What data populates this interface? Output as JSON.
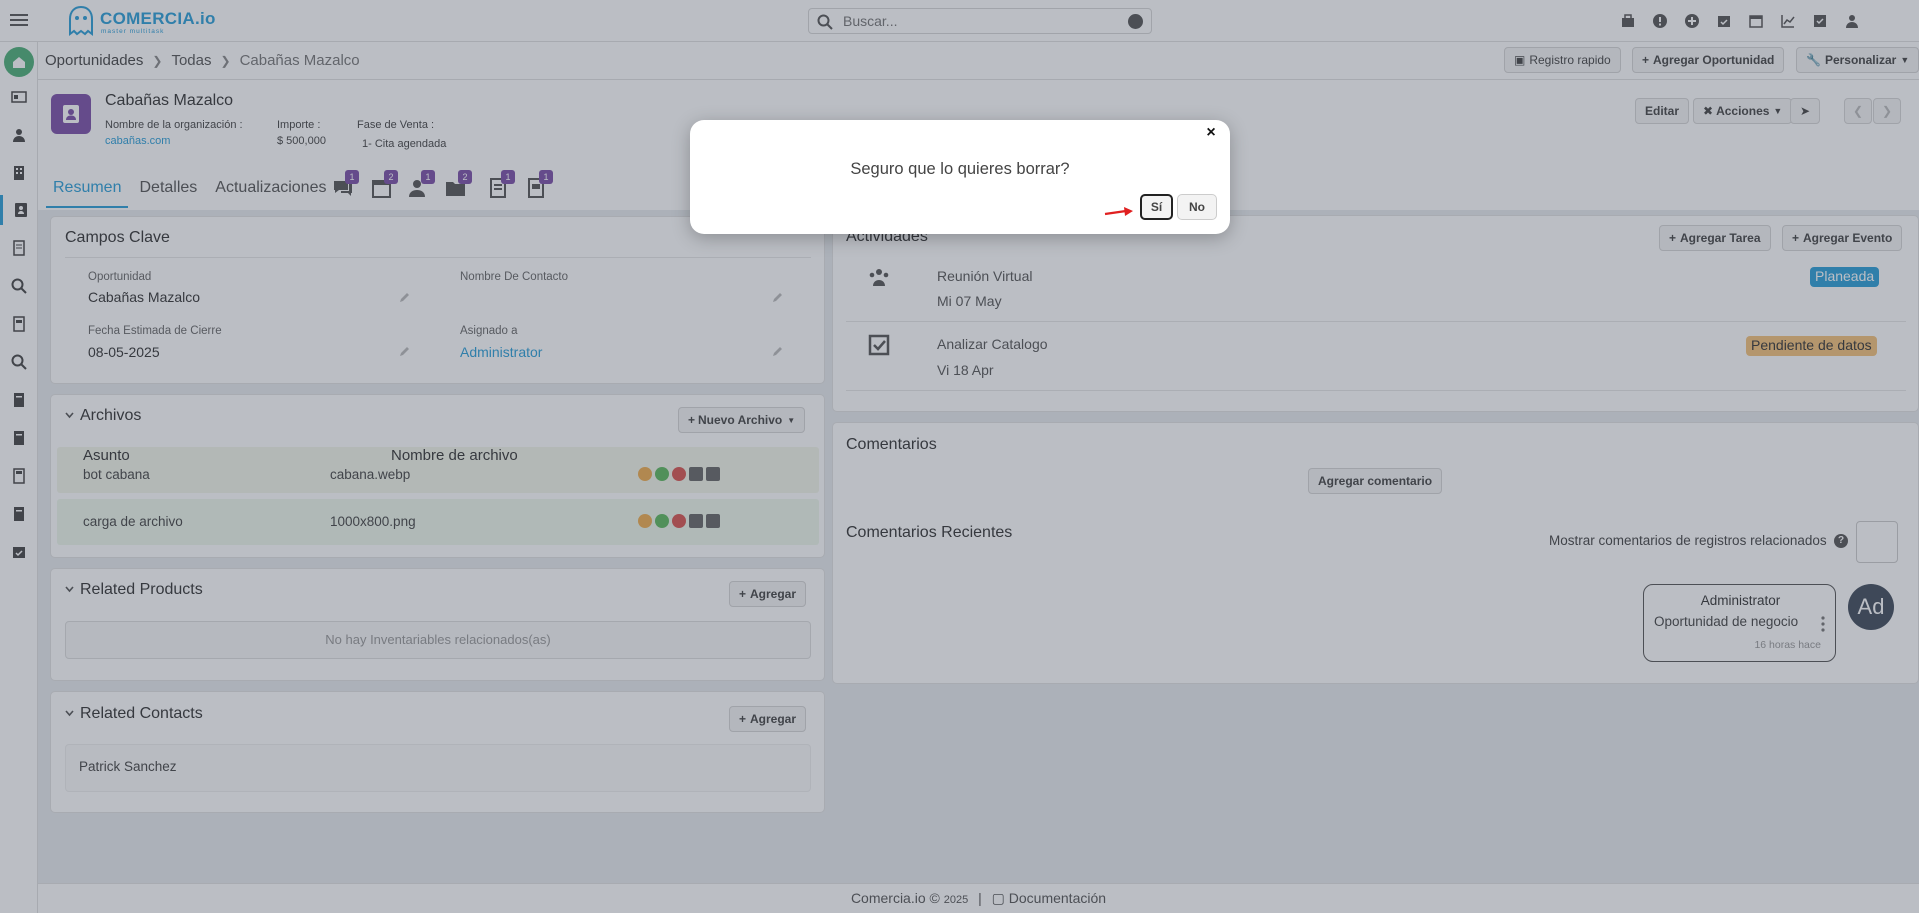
{
  "app": {
    "logo_text": "COMERCIA.io",
    "logo_sub": "master multitask",
    "search_placeholder": "Buscar..."
  },
  "top_icons": [
    "briefcase-icon",
    "alert-icon",
    "plus-circle-icon",
    "calendar-check-icon",
    "calendar-icon",
    "chart-icon",
    "checkbox-icon",
    "user-icon"
  ],
  "sidebar": [
    "home-icon",
    "id-card-icon",
    "person-icon",
    "building-icon",
    "contact-icon",
    "book-icon",
    "search-plus-icon",
    "ledger-icon",
    "search-icon",
    "book-2-icon",
    "book-3-icon",
    "calculator-icon",
    "book-4-icon",
    "calendar-icon"
  ],
  "breadcrumb": {
    "level1": "Oportunidades",
    "level2": "Todas",
    "level3": "Cabañas Mazalco"
  },
  "header_buttons": {
    "quick": "Registro rapido",
    "add": "Agregar Oportunidad",
    "customize": "Personalizar"
  },
  "record": {
    "title": "Cabañas Mazalco",
    "org_label": "Nombre de la organización :",
    "org_value": "cabañas.com",
    "amount_label": "Importe :",
    "amount_value": "$ 500,000",
    "stage_label": "Fase de Venta :",
    "stage_value": "1- Cita agendada",
    "edit": "Editar",
    "actions": "Acciones"
  },
  "tabs": {
    "summary": "Resumen",
    "details": "Detalles",
    "updates": "Actualizaciones",
    "icon_badges": [
      "1",
      "2",
      "1",
      "2",
      "1",
      "1"
    ]
  },
  "key_fields": {
    "title": "Campos Clave",
    "opportunity_label": "Oportunidad",
    "opportunity_value": "Cabañas Mazalco",
    "contact_label": "Nombre De Contacto",
    "contact_value": "",
    "close_date_label": "Fecha Estimada de Cierre",
    "close_date_value": "08-05-2025",
    "assigned_label": "Asignado a",
    "assigned_value": "Administrator"
  },
  "files": {
    "title": "Archivos",
    "new_button": "Nuevo Archivo",
    "col_subject": "Asunto",
    "col_filename": "Nombre de archivo",
    "rows": [
      {
        "subject": "bot cabana",
        "filename": "cabana.webp"
      },
      {
        "subject": "carga de archivo",
        "filename": "1000x800.png"
      }
    ]
  },
  "related_products": {
    "title": "Related Products",
    "add": "Agregar",
    "empty": "No hay Inventariables relacionados(as)"
  },
  "related_contacts": {
    "title": "Related Contacts",
    "add": "Agregar",
    "contact": "Patrick Sanchez"
  },
  "activities": {
    "title": "Actividades",
    "add_task": "Agregar Tarea",
    "add_event": "Agregar Evento",
    "items": [
      {
        "name": "Reunión Virtual",
        "date": "Mi 07 May",
        "status": "Planeada",
        "status_color": "#2a9ed8"
      },
      {
        "name": "Analizar Catalogo",
        "date": "Vi 18 Apr",
        "status": "Pendiente de datos",
        "status_color": "#f5a623"
      }
    ]
  },
  "comments": {
    "title": "Comentarios",
    "add": "Agregar comentario",
    "recent_title": "Comentarios Recientes",
    "show_related": "Mostrar comentarios de registros relacionados",
    "bubble_author": "Administrator",
    "bubble_text": "Oportunidad de negocio",
    "bubble_time": "16 horas hace",
    "avatar": "Ad"
  },
  "footer": {
    "brand": "Comercia.io ©",
    "year": "2025",
    "docs": "Documentación"
  },
  "modal": {
    "question": "Seguro que lo quieres borrar?",
    "yes": "Sí",
    "no": "No",
    "close": "×"
  }
}
